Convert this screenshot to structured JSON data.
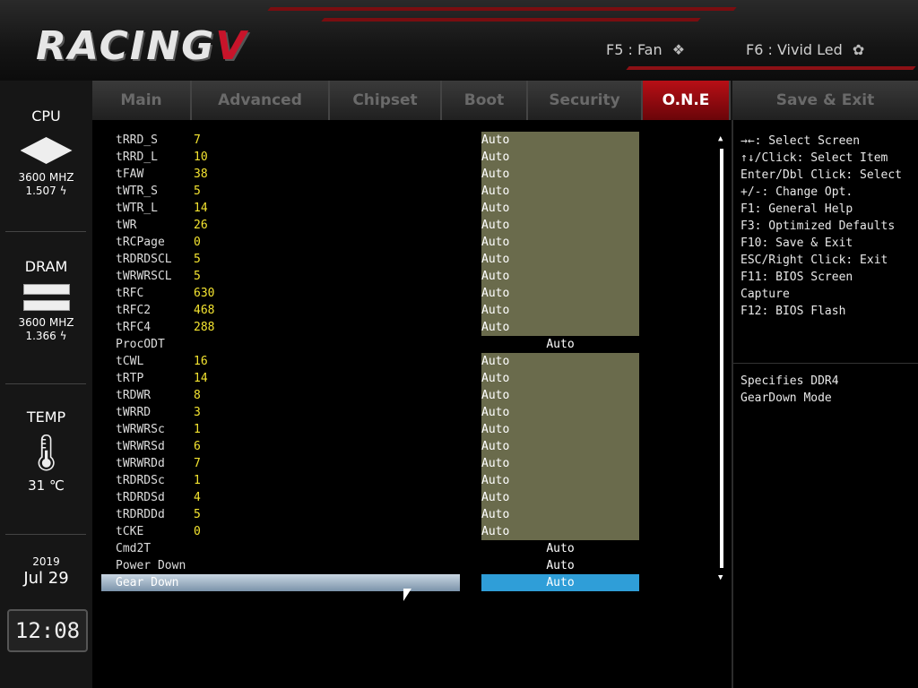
{
  "header": {
    "logo_text": "RACING",
    "logo_accent": "V",
    "f5_label": "F5 : Fan",
    "f6_label": "F6 : Vivid Led",
    "fan_icon": "fan-icon",
    "led_icon": "led-icon",
    "accent_color": "#b80f16"
  },
  "sidebar": {
    "cpu": {
      "title": "CPU",
      "freq": "3600 MHZ",
      "volt": "1.507 ϟ"
    },
    "dram": {
      "title": "DRAM",
      "freq": "3600 MHZ",
      "volt": "1.366 ϟ"
    },
    "temp": {
      "title": "TEMP",
      "value": "31 ℃"
    },
    "date": {
      "year": "2019",
      "month": "Jul",
      "day": "29"
    },
    "time": "12:08"
  },
  "tabs": [
    {
      "label": "Main"
    },
    {
      "label": "Advanced"
    },
    {
      "label": "Chipset"
    },
    {
      "label": "Boot"
    },
    {
      "label": "Security"
    },
    {
      "label": "O.N.E"
    },
    {
      "label": "Save & Exit"
    }
  ],
  "active_tab": "O.N.E",
  "rows": [
    {
      "label": "tRRD_S",
      "num": "7",
      "value": "Auto"
    },
    {
      "label": "tRRD_L",
      "num": "10",
      "value": "Auto"
    },
    {
      "label": "tFAW",
      "num": "38",
      "value": "Auto"
    },
    {
      "label": "tWTR_S",
      "num": "5",
      "value": "Auto"
    },
    {
      "label": "tWTR_L",
      "num": "14",
      "value": "Auto"
    },
    {
      "label": "tWR",
      "num": "26",
      "value": "Auto"
    },
    {
      "label": "tRCPage",
      "num": "0",
      "value": "Auto"
    },
    {
      "label": "tRDRDSCL",
      "num": "5",
      "value": "Auto"
    },
    {
      "label": "tWRWRSCL",
      "num": "5",
      "value": "Auto"
    },
    {
      "label": "tRFC",
      "num": "630",
      "value": "Auto"
    },
    {
      "label": "tRFC2",
      "num": "468",
      "value": "Auto"
    },
    {
      "label": "tRFC4",
      "num": "288",
      "value": "Auto"
    },
    {
      "label": "ProcODT",
      "num": "",
      "value": "Auto"
    },
    {
      "label": "tCWL",
      "num": "16",
      "value": "Auto"
    },
    {
      "label": "tRTP",
      "num": "14",
      "value": "Auto"
    },
    {
      "label": "tRDWR",
      "num": "8",
      "value": "Auto"
    },
    {
      "label": "tWRRD",
      "num": "3",
      "value": "Auto"
    },
    {
      "label": "tWRWRSc",
      "num": "1",
      "value": "Auto"
    },
    {
      "label": "tWRWRSd",
      "num": "6",
      "value": "Auto"
    },
    {
      "label": "tWRWRDd",
      "num": "7",
      "value": "Auto"
    },
    {
      "label": "tRDRDSc",
      "num": "1",
      "value": "Auto"
    },
    {
      "label": "tRDRDSd",
      "num": "4",
      "value": "Auto"
    },
    {
      "label": "tRDRDDd",
      "num": "5",
      "value": "Auto"
    },
    {
      "label": "tCKE",
      "num": "0",
      "value": "Auto"
    },
    {
      "label": "Cmd2T",
      "num": "",
      "value": "Auto"
    },
    {
      "label": "Power Down",
      "num": "",
      "value": "Auto"
    },
    {
      "label": "Gear Down",
      "num": "",
      "value": "Auto"
    }
  ],
  "help": {
    "keys": [
      "→←: Select Screen",
      "↑↓/Click: Select Item",
      "Enter/Dbl Click: Select",
      "+/-: Change Opt.",
      "F1: General Help",
      "F3: Optimized Defaults",
      "F10: Save & Exit",
      "ESC/Right Click: Exit",
      "F11: BIOS Screen",
      "Capture",
      "F12: BIOS Flash"
    ],
    "description": [
      "Specifies DDR4",
      "GearDown Mode"
    ]
  }
}
